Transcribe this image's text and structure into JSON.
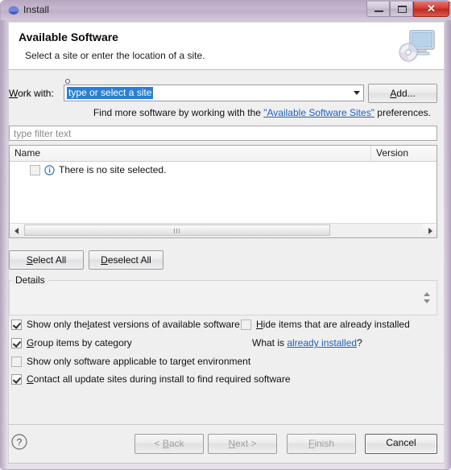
{
  "window": {
    "title": "Install",
    "app_icon": "eclipse-globe-icon",
    "controls": {
      "minimize": "Minimize",
      "maximize": "Maximize",
      "close": "✕"
    }
  },
  "banner": {
    "title": "Available Software",
    "subtitle": "Select a site or enter the location of a site.",
    "icon": "install-monitor-disc-icon"
  },
  "work_with": {
    "label_prefix": "W",
    "label_rest": "ork with:",
    "value": "type or select a site",
    "add_button": {
      "mnemonic": "A",
      "rest": "dd..."
    },
    "hint_before": "Find more software by working with the ",
    "hint_link": "\"Available Software Sites\"",
    "hint_after": " preferences."
  },
  "filter": {
    "placeholder": "type filter text"
  },
  "table": {
    "columns": [
      "Name",
      "Version"
    ],
    "rows": [
      {
        "checked": false,
        "icon": "info-icon",
        "label": "There is no site selected.",
        "version": ""
      }
    ],
    "scrollbar": {
      "left_arrow": "◀",
      "right_arrow": "▶"
    }
  },
  "selection_buttons": {
    "select_all": {
      "mnemonic": "S",
      "rest": "elect All"
    },
    "deselect_all": {
      "mnemonic": "D",
      "rest": "eselect All"
    }
  },
  "details": {
    "legend": "Details",
    "body": ""
  },
  "options": [
    {
      "checked": true,
      "pre": "Show only the ",
      "mnemonic": "l",
      "post": "atest versions of available software"
    },
    {
      "checked": true,
      "pre": "",
      "mnemonic": "G",
      "post": "roup items by category"
    },
    {
      "checked": false,
      "pre": "",
      "mnemonic": "S",
      "post": "how only software applicable to target environment"
    },
    {
      "checked": true,
      "pre": "",
      "mnemonic": "C",
      "post": "ontact all update sites during install to find required software"
    },
    {
      "checked": false,
      "pre": "",
      "mnemonic": "H",
      "post": "ide items that are already installed"
    }
  ],
  "what_is": {
    "prefix": "What is ",
    "link": "already installed",
    "suffix": "?"
  },
  "footer": {
    "help_icon": "help-question-icon",
    "back": {
      "text": "< ",
      "mnemonic": "B",
      "rest": "ack",
      "enabled": false
    },
    "next": {
      "text": "",
      "mnemonic": "N",
      "rest": "ext >",
      "enabled": false
    },
    "finish": {
      "text": "",
      "mnemonic": "F",
      "rest": "inish",
      "enabled": false
    },
    "cancel": {
      "text": "Cancel",
      "enabled": true
    }
  },
  "colors": {
    "window_frame": "#cfc3d6",
    "titlebar": "#bfb0c9",
    "close_button": "#d23b30",
    "selection_blue": "#2a7fd4",
    "link_blue": "#1f5fbf",
    "panel_bg": "#efeff0",
    "field_bg": "#ffffff"
  }
}
